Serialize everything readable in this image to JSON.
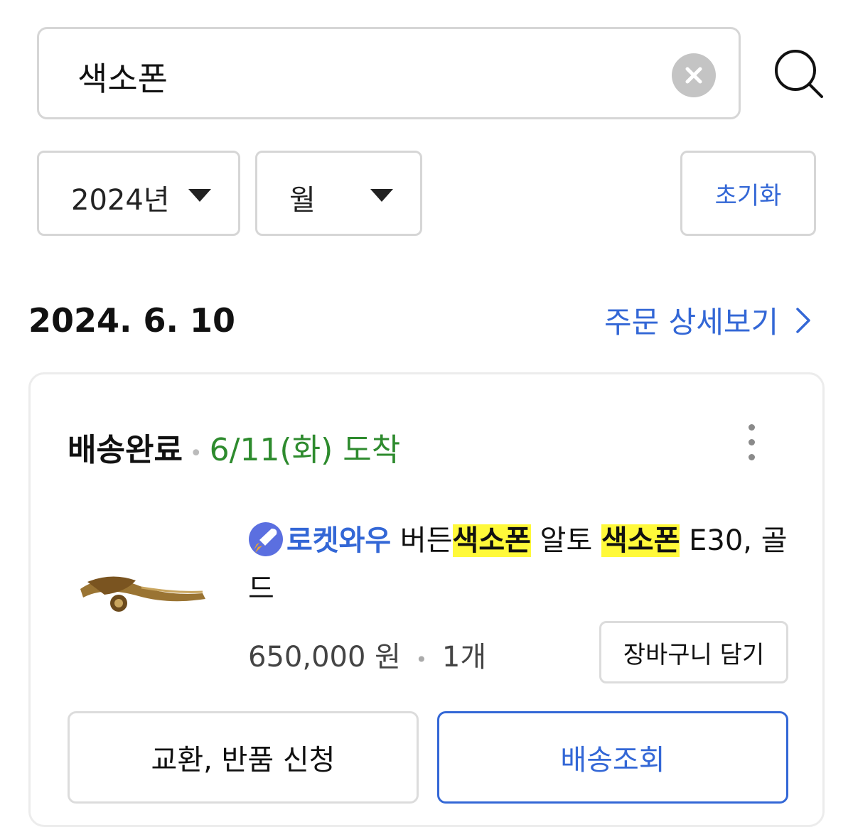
{
  "search": {
    "query": "색소폰"
  },
  "filters": {
    "year": "2024년",
    "month": "월",
    "reset_label": "초기화"
  },
  "order": {
    "date": "2024. 6. 10",
    "detail_link": "주문 상세보기",
    "status": "배송완료",
    "arrival": "6/11(화) 도착",
    "product": {
      "badge": "로켓와우",
      "name_parts": [
        "버든",
        "색소폰",
        " 알토 ",
        "색소폰",
        " E30, 골드"
      ],
      "price": "650,000 원",
      "quantity": "1개"
    },
    "cart_button": "장바구니 담기",
    "exchange_button": "교환, 반품 신청",
    "tracking_button": "배송조회"
  },
  "colors": {
    "link_blue": "#3367d6",
    "arrival_green": "#2e8b2e",
    "highlight": "#fff93a"
  },
  "icons": {
    "clear": "clear-icon",
    "search": "search-icon",
    "more": "more-vertical-icon",
    "rocket": "rocket-icon",
    "chevron": "chevron-right-icon"
  }
}
